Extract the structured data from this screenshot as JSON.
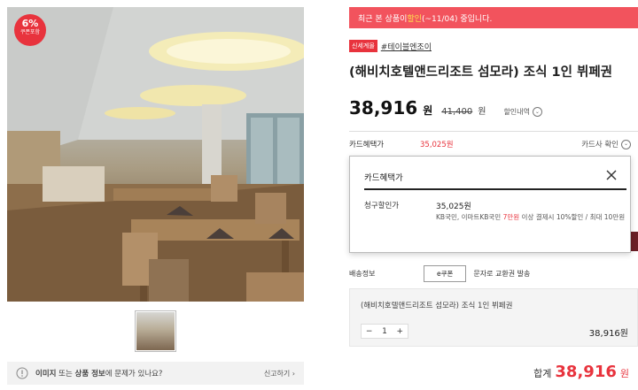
{
  "product": {
    "coupon_badge": {
      "percent": "6%",
      "label": "쿠폰포함"
    },
    "tags": {
      "new": "신세계몰",
      "brand": "#테이블엔조이"
    },
    "title": "(해비치호텔앤드리조트 섬모라) 조식 1인 뷔페권",
    "price": "38,916",
    "currency": "원",
    "original_price": "41,400",
    "discount_detail_label": "할인내역"
  },
  "banner": {
    "prefix": "최근 본 상품이 ",
    "highlight": "할인",
    "suffix": "(~11/04) 중입니다."
  },
  "card_benefit": {
    "label": "카드혜택가",
    "value": "35,025원",
    "check_label": "카드사 확인"
  },
  "popup": {
    "title": "카드혜택가",
    "claim_label": "청구할인가",
    "amount": "35,025원",
    "desc_prefix": "KB국민, 이마트KB국민 ",
    "desc_highlight": "7만원",
    "desc_suffix": " 이상 결제시 10%할인 / 최대 10만원"
  },
  "shipping": {
    "label": "배송정보",
    "type": "e쿠폰",
    "note": "문자로 교환권 발송"
  },
  "option": {
    "name": "(해비치호텔앤드리조트 섬모라) 조식 1인 뷔페권",
    "quantity": "1",
    "price": "38,916원",
    "minus": "−",
    "plus": "+"
  },
  "total": {
    "label": "합계",
    "value": "38,916",
    "currency": "원"
  },
  "report": {
    "msg_part1": "이미지",
    "msg_part2": " 또는 ",
    "msg_part3": "상품 정보",
    "msg_part4": "에 문제가 있나요?",
    "link": "신고하기 ›"
  },
  "icons": {
    "close": "close-icon",
    "warning": "warning-icon",
    "chevron": "chevron-down-icon"
  },
  "colors": {
    "accent": "#e8333d",
    "banner": "#f2535d"
  }
}
